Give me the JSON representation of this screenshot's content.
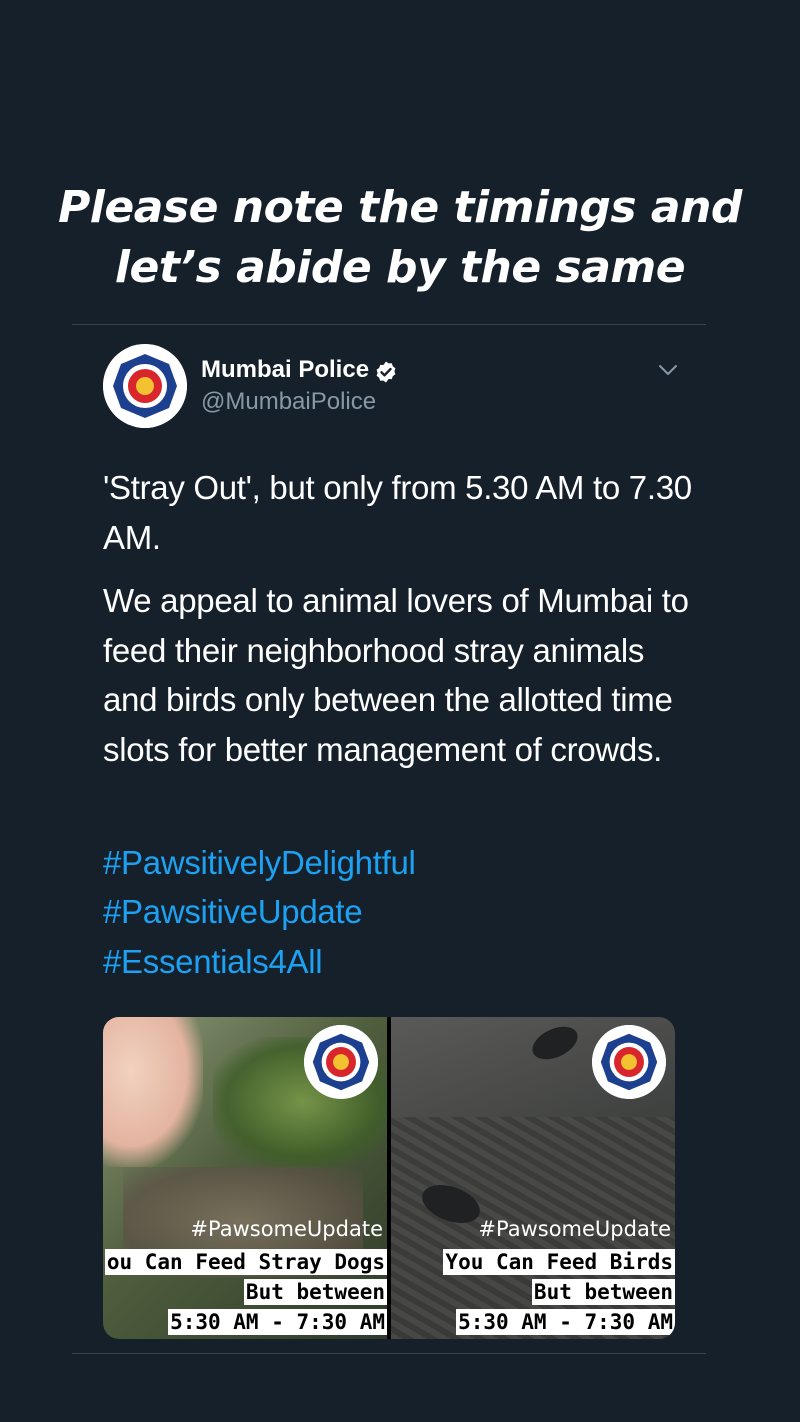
{
  "story": {
    "caption_line1": "Please note the timings and",
    "caption_line2": "let’s abide by the same"
  },
  "tweet": {
    "author": {
      "name": "Mumbai Police",
      "handle": "@MumbaiPolice"
    },
    "paragraph1": "'Stray Out', but only from 5.30 AM to 7.30 AM.",
    "paragraph2": "We appeal to animal lovers of Mumbai to feed their neighborhood stray animals and birds only between the allotted time slots for better management of crowds.",
    "hashtags": [
      "#PawsitivelyDelightful",
      "#PawsitiveUpdate",
      "#Essentials4All"
    ],
    "media": [
      {
        "tag": "#PawsomeUpdate",
        "line1": "ou Can Feed Stray Dogs",
        "line2": "But between",
        "line3": "5:30 AM - 7:30 AM"
      },
      {
        "tag": "#PawsomeUpdate",
        "line1": "You Can Feed Birds",
        "line2": "But between",
        "line3": "5:30 AM - 7:30 AM"
      }
    ]
  },
  "colors": {
    "background": "#15202b",
    "text": "#ffffff",
    "secondary": "#8899a6",
    "link": "#1da1f2"
  },
  "icons": [
    "verified-badge-icon",
    "chevron-down-icon",
    "mumbai-police-logo"
  ]
}
